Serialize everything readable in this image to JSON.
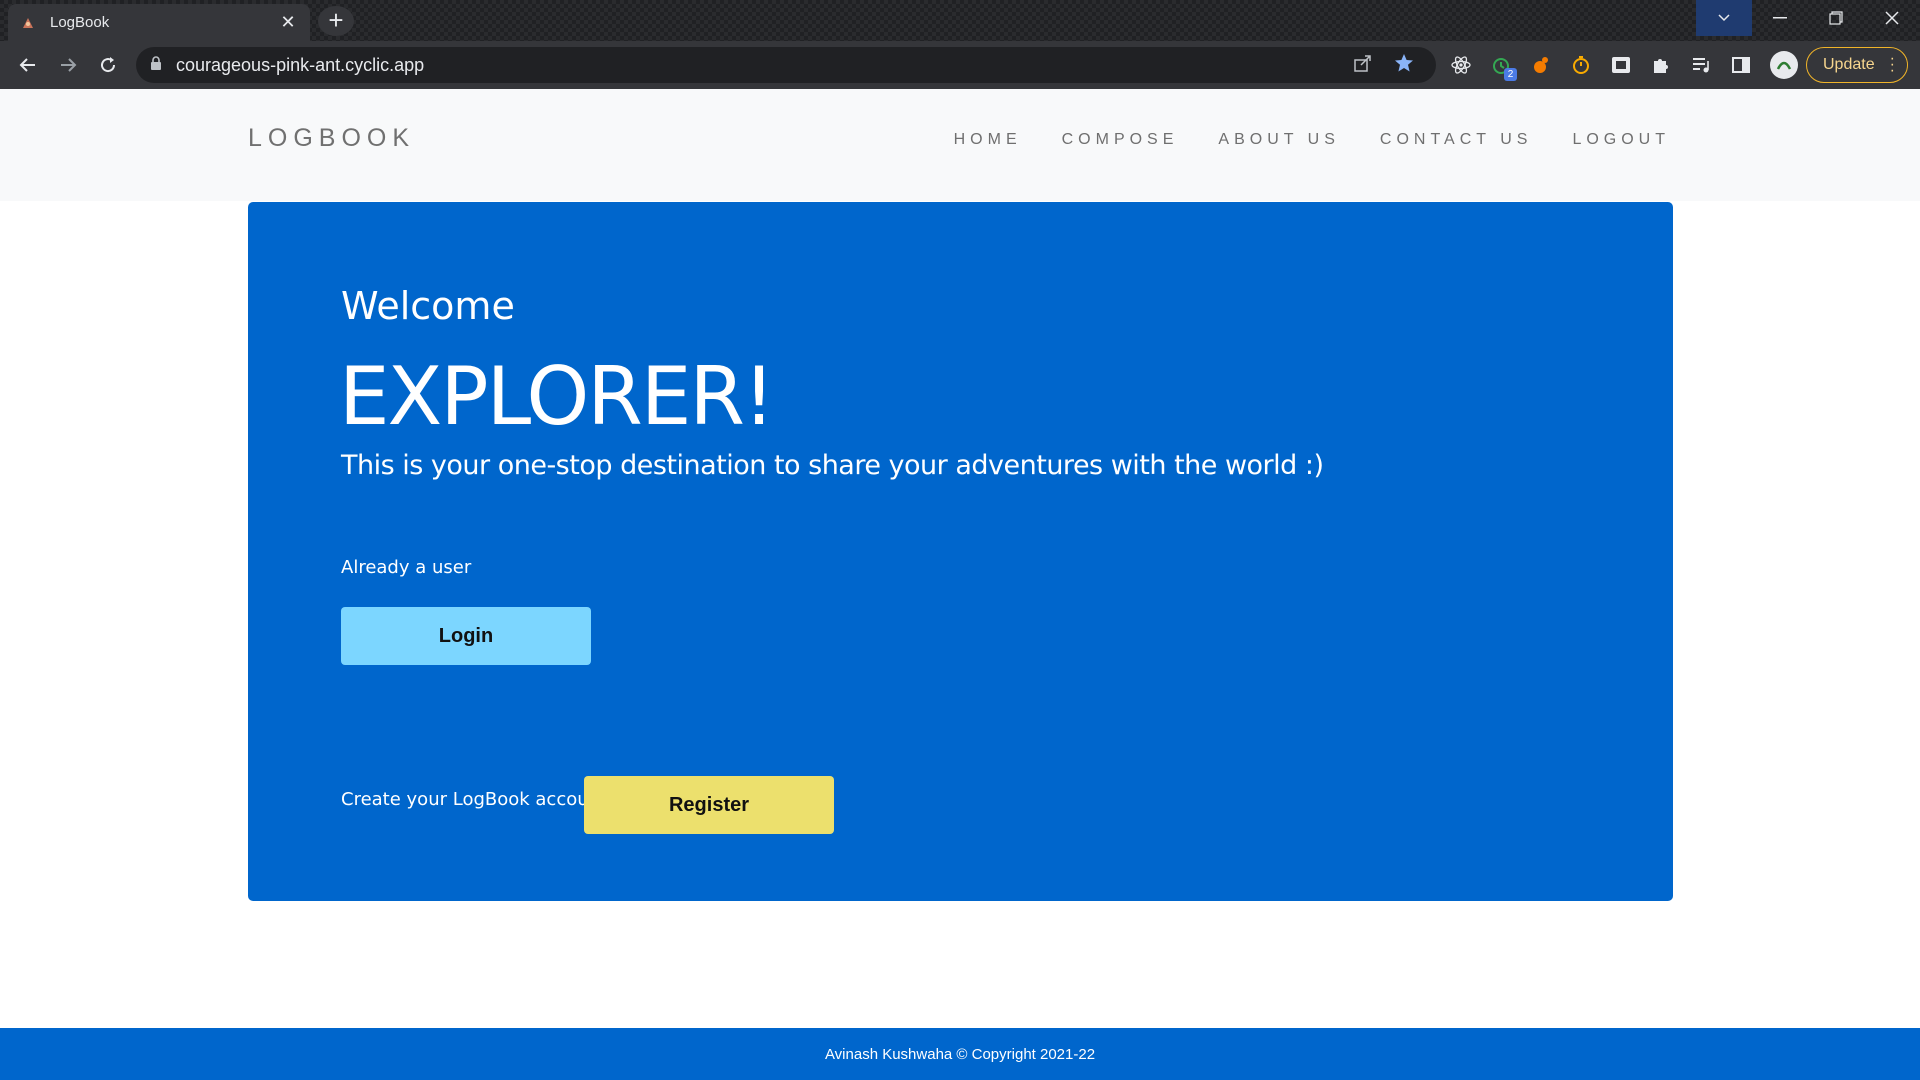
{
  "browser": {
    "tab_title": "LogBook",
    "url": "courageous-pink-ant.cyclic.app",
    "update_label": "Update",
    "extension_badge": "2",
    "icons": {
      "back": "arrow-left-icon",
      "forward": "arrow-right-icon",
      "reload": "reload-icon",
      "lock": "lock-icon",
      "share": "share-icon",
      "bookmark": "star-icon",
      "extensions": "puzzle-icon"
    }
  },
  "site": {
    "brand": "LOGBOOK",
    "nav": [
      "HOME",
      "COMPOSE",
      "ABOUT US",
      "CONTACT US",
      "LOGOUT"
    ]
  },
  "hero": {
    "welcome": "Welcome",
    "headline": "EXPLORER!",
    "tagline": "This is your one-stop destination to share your adventures with the world :)",
    "already_user": "Already a user",
    "login_label": "Login",
    "create_account": "Create your LogBook account",
    "register_label": "Register"
  },
  "footer": {
    "text": "Avinash Kushwaha © Copyright 2021-22"
  },
  "colors": {
    "hero_bg": "#0066cc",
    "login_btn": "#7cd6ff",
    "register_btn": "#ece06d",
    "header_bg": "#f8f9fa"
  }
}
